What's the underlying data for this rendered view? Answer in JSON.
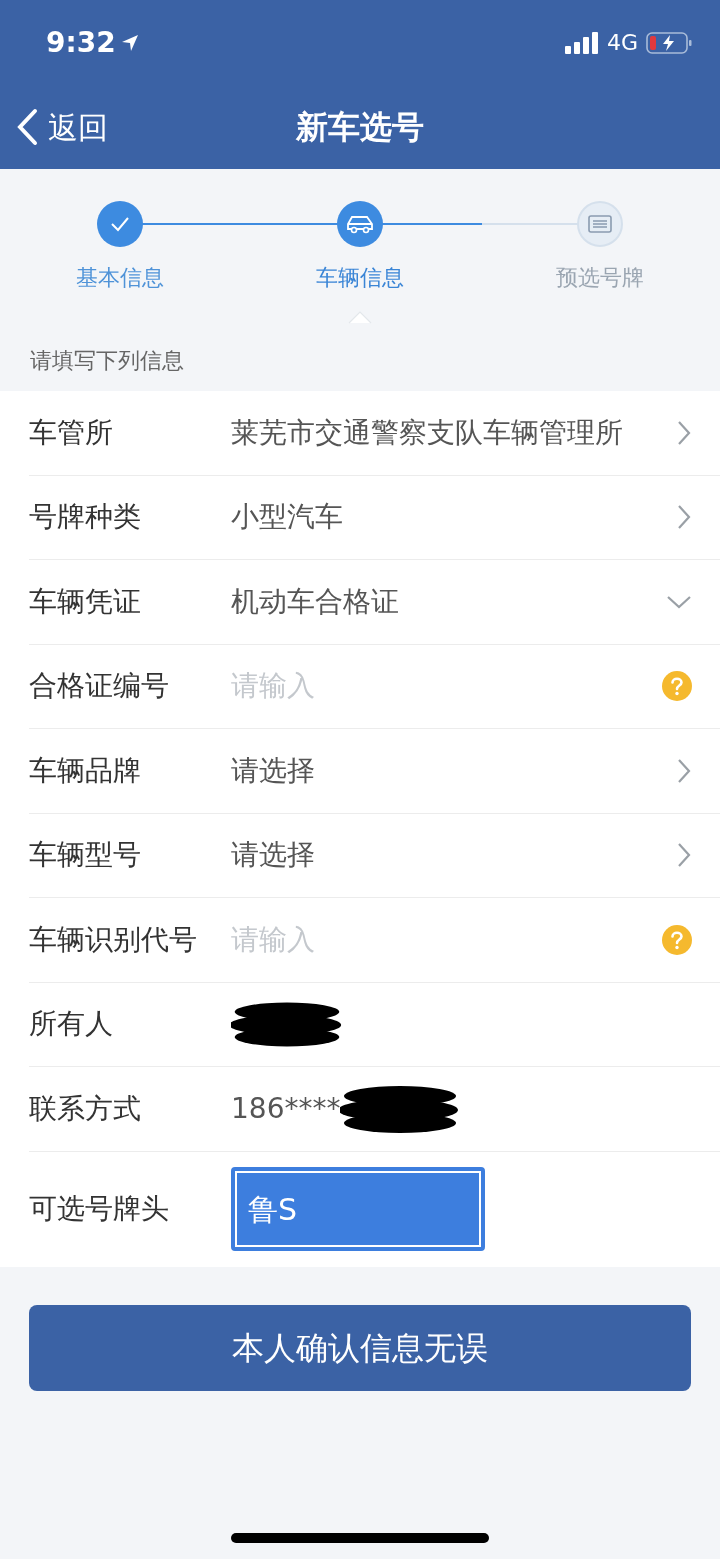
{
  "status_bar": {
    "time": "9:32",
    "network": "4G"
  },
  "nav": {
    "back": "返回",
    "title": "新车选号"
  },
  "stepper": {
    "progress": {
      "level": 0.75
    },
    "steps": [
      {
        "label": "基本信息",
        "selected": false
      },
      {
        "label": "车辆信息",
        "selected": true
      },
      {
        "label": "预选号牌",
        "selected": false
      }
    ]
  },
  "section_label": "请填写下列信息",
  "rows": [
    {
      "label": "车管所",
      "kind": "link",
      "value": "莱芜市交通警察支队车辆管理所"
    },
    {
      "label": "号牌种类",
      "kind": "link",
      "value": "小型汽车"
    },
    {
      "label": "车辆凭证",
      "kind": "dropdown",
      "value": "机动车合格证"
    },
    {
      "label": "合格证编号",
      "kind": "input",
      "placeholder": "请输入"
    },
    {
      "label": "车辆品牌",
      "kind": "link",
      "value": "请选择"
    },
    {
      "label": "车辆型号",
      "kind": "link",
      "value": "请选择"
    },
    {
      "label": "车辆识别代号",
      "kind": "input",
      "placeholder": "请输入"
    },
    {
      "label": "所有人",
      "kind": "text",
      "redacted": true
    },
    {
      "label": "联系方式",
      "kind": "text",
      "value": "186****",
      "redacted": true
    },
    {
      "label": "可选号牌头",
      "kind": "chip",
      "value": "鲁S",
      "selected": true
    }
  ],
  "confirm_button": "本人确认信息无误"
}
